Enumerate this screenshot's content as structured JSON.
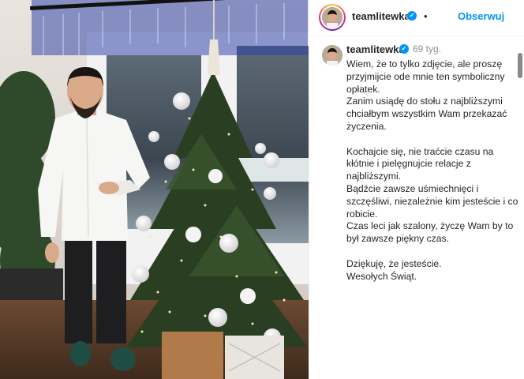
{
  "post": {
    "username": "teamlitewka",
    "follow_label": "Obserwuj",
    "separator": "•",
    "time_ago": "69 tyg.",
    "verified_mark": "✓",
    "caption_lines": [
      "Wiem, że to tylko zdjęcie, ale proszę",
      "przyjmijcie ode mnie ten symboliczny",
      "opłatek.",
      "Zanim usiądę do stołu z najbliższymi",
      "chciałbym wszystkim Wam przekazać",
      "życzenia.",
      "",
      "Kochajcie się, nie traćcie czasu na",
      "kłótnie i pielęgnujcie relacje z",
      "najbliższymi.",
      "Bądźcie zawsze uśmiechnięci i",
      "szczęśliwi, niezależnie kim jesteście i co",
      "robicie.",
      "Czas leci jak szalony, życzę Wam by to",
      "był zawsze piękny czas.",
      "",
      "Dziękuję, że jesteście.",
      "Wesołych Świąt."
    ]
  },
  "colors": {
    "accent": "#0095f6",
    "text": "#262626",
    "muted": "#8e8e8e"
  },
  "icons": {
    "verified": "verified-badge-icon",
    "scroll": "scroll-up-arrow-icon"
  }
}
